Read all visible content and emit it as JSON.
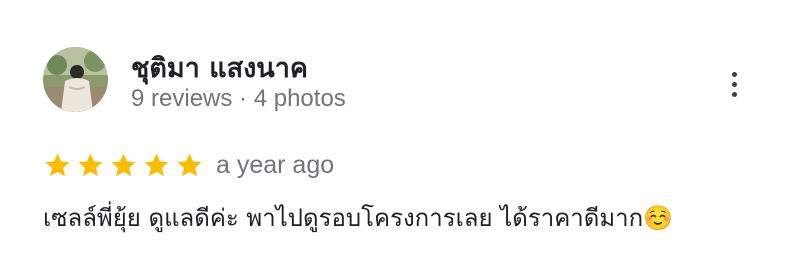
{
  "review": {
    "author": {
      "name": "ชุติมา แสงนาค",
      "reviews_count": "9 reviews",
      "separator": "·",
      "photos_count": "4 photos"
    },
    "rating": 5,
    "time_ago": "a year ago",
    "text": "เซลล์พี่ยุ้ย ดูแลดีค่ะ พาไปดูรอบโครงการเลย ได้ราคาดีมาก☺️",
    "colors": {
      "star": "#fbbc04",
      "secondary_text": "#70757a",
      "primary_text": "#202124"
    },
    "icons": {
      "more": "more-vert-icon",
      "star": "star-icon"
    }
  }
}
